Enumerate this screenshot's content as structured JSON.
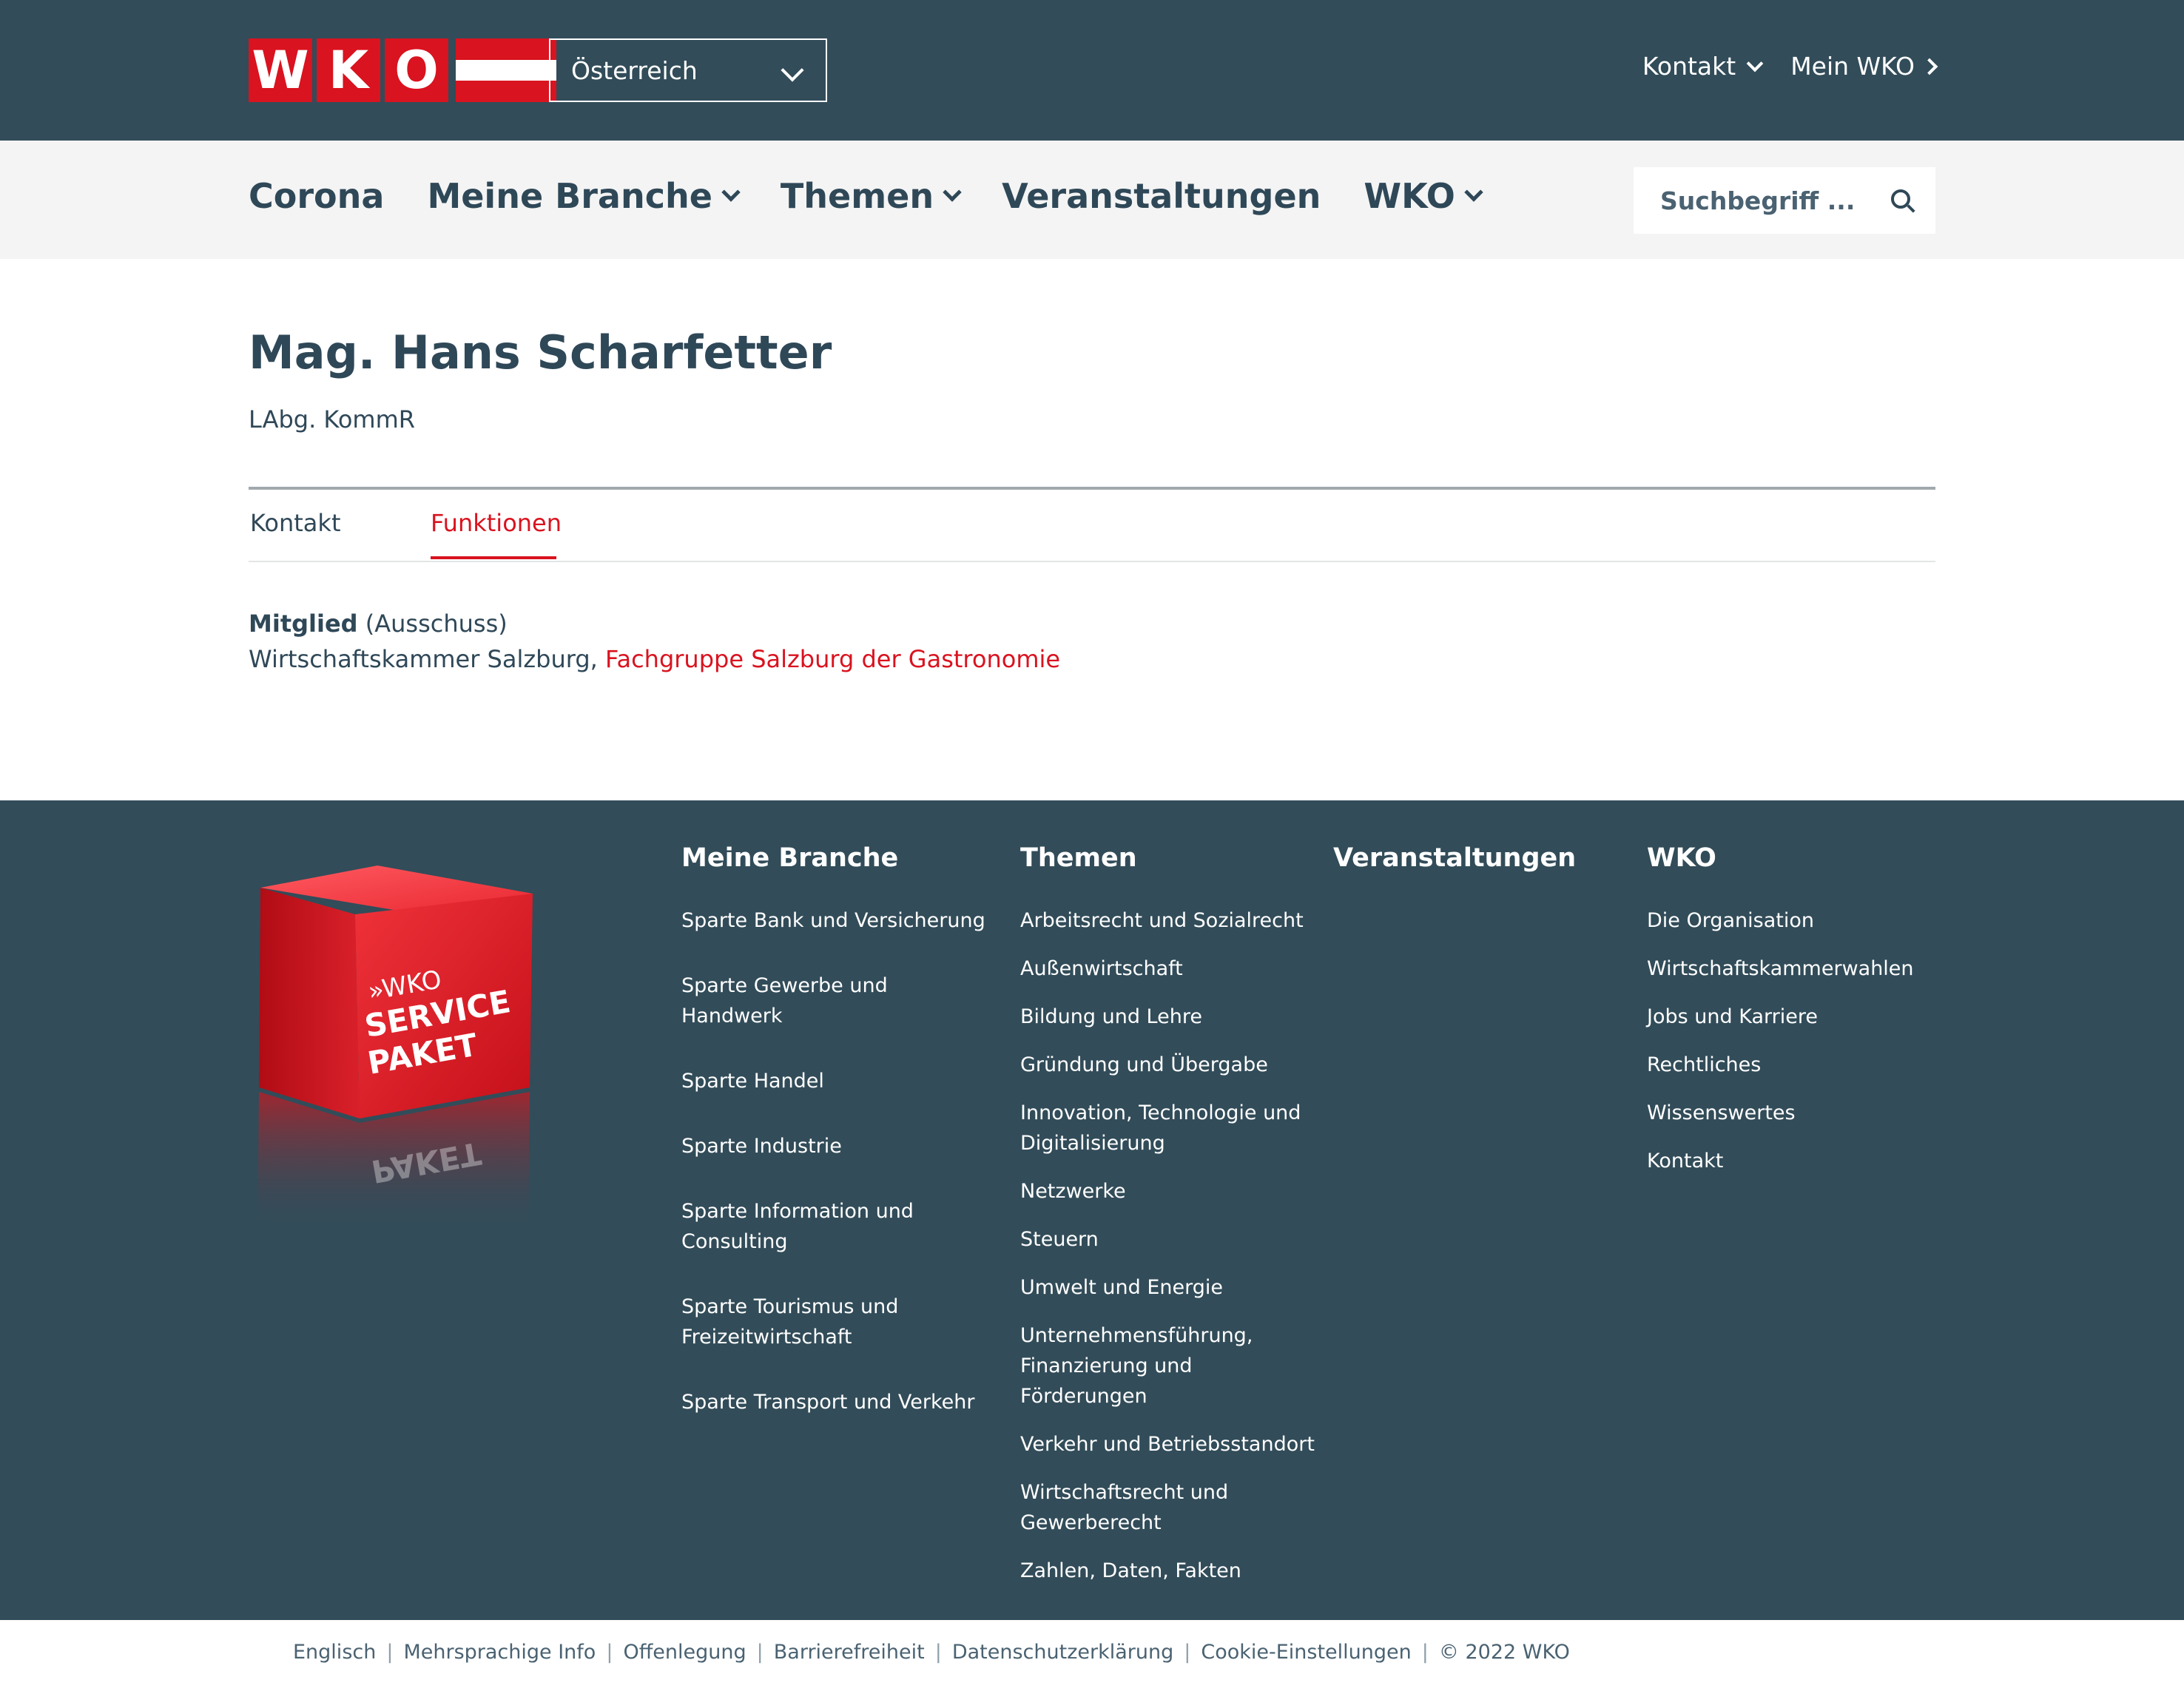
{
  "header": {
    "logo_letters": [
      "W",
      "K",
      "O"
    ],
    "region": "Österreich",
    "kontakt": "Kontakt",
    "mein_wko": "Mein WKO"
  },
  "nav": {
    "items": [
      {
        "label": "Corona",
        "dropdown": false
      },
      {
        "label": "Meine Branche",
        "dropdown": true
      },
      {
        "label": "Themen",
        "dropdown": true
      },
      {
        "label": "Veranstaltungen",
        "dropdown": false
      },
      {
        "label": "WKO",
        "dropdown": true
      }
    ],
    "search_placeholder": "Suchbegriff ..."
  },
  "person": {
    "name": "Mag. Hans Scharfetter",
    "title": "LAbg. KommR"
  },
  "tabs": {
    "kontakt": "Kontakt",
    "funktionen": "Funktionen",
    "active": "Funktionen"
  },
  "function": {
    "role": "Mitglied",
    "role_detail": "(Ausschuss)",
    "organization": "Wirtschaftskammer Salzburg,",
    "group_link": "Fachgruppe Salzburg der Gastronomie"
  },
  "promo": {
    "prefix": "»WKO",
    "line1": "SERVICE",
    "line2": "PAKET",
    "mirror": "PAKET"
  },
  "footer": {
    "meine_branche": {
      "title": "Meine Branche",
      "items": [
        "Sparte Bank und Versicherung",
        "Sparte Gewerbe und Handwerk",
        "Sparte Handel",
        "Sparte Industrie",
        "Sparte Information und Consulting",
        "Sparte Tourismus und Freizeitwirtschaft",
        "Sparte Transport und Verkehr"
      ]
    },
    "themen": {
      "title": "Themen",
      "items": [
        "Arbeitsrecht und Sozialrecht",
        "Außenwirtschaft",
        "Bildung und Lehre",
        "Gründung und Übergabe",
        "Innovation, Technologie und Digitalisierung",
        "Netzwerke",
        "Steuern",
        "Umwelt und Energie",
        "Unternehmensführung, Finanzierung und Förderungen",
        "Verkehr und Betriebsstandort",
        "Wirtschaftsrecht und Gewerberecht",
        "Zahlen, Daten, Fakten"
      ]
    },
    "veranstaltungen": {
      "title": "Veranstaltungen"
    },
    "wko": {
      "title": "WKO",
      "items": [
        "Die Organisation",
        "Wirtschaftskammerwahlen",
        "Jobs und Karriere",
        "Rechtliches",
        "Wissenswertes",
        "Kontakt"
      ]
    }
  },
  "legal": {
    "items": [
      "Englisch",
      "Mehrsprachige Info",
      "Offenlegung",
      "Barrierefreiheit",
      "Datenschutzerklärung",
      "Cookie-Einstellungen"
    ],
    "copyright": "© 2022 WKO"
  },
  "colors": {
    "brand_red": "#d9131f",
    "header_bg": "#324c59",
    "nav_bg": "#f4f4f4",
    "text": "#2f4858"
  }
}
